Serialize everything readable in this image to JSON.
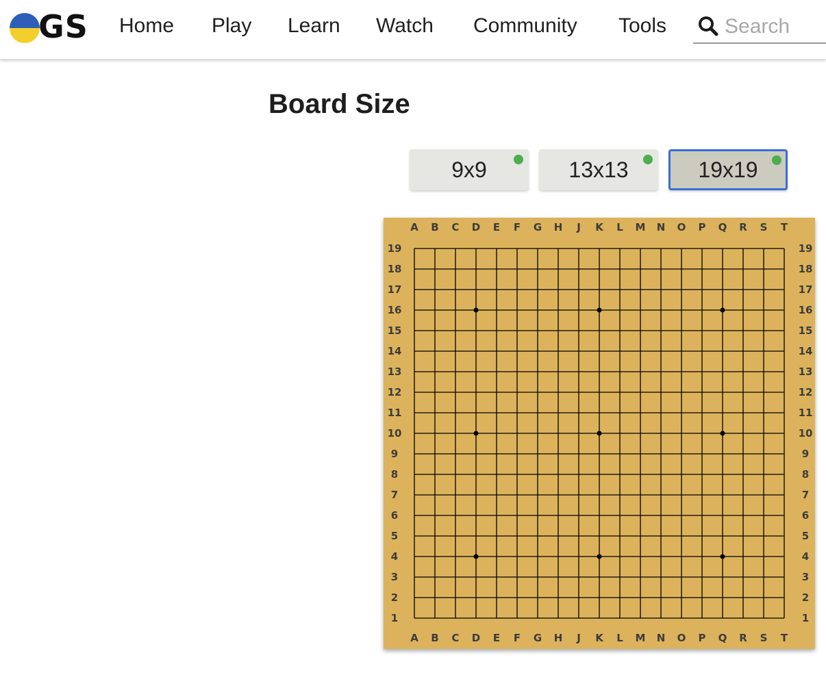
{
  "header": {
    "logo_text": "GS",
    "nav": [
      "Home",
      "Play",
      "Learn",
      "Watch",
      "Community",
      "Tools"
    ],
    "search_placeholder": "Search"
  },
  "main": {
    "title": "Board Size",
    "size_options": [
      {
        "label": "9x9",
        "selected": false,
        "status": "online"
      },
      {
        "label": "13x13",
        "selected": false,
        "status": "online"
      },
      {
        "label": "19x19",
        "selected": true,
        "status": "online"
      }
    ]
  },
  "board": {
    "size": 19,
    "columns": [
      "A",
      "B",
      "C",
      "D",
      "E",
      "F",
      "G",
      "H",
      "J",
      "K",
      "L",
      "M",
      "N",
      "O",
      "P",
      "Q",
      "R",
      "S",
      "T"
    ],
    "rows": [
      "19",
      "18",
      "17",
      "16",
      "15",
      "14",
      "13",
      "12",
      "11",
      "10",
      "9",
      "8",
      "7",
      "6",
      "5",
      "4",
      "3",
      "2",
      "1"
    ],
    "star_points": [
      "D16",
      "K16",
      "Q16",
      "D10",
      "K10",
      "Q10",
      "D4",
      "K4",
      "Q4"
    ]
  },
  "colors": {
    "board": "#dcb35c",
    "selected_border": "#3a6fd8",
    "status_dot": "#4cae4c",
    "logo_blue": "#2d5fb8",
    "logo_yellow": "#f3cf2c"
  }
}
